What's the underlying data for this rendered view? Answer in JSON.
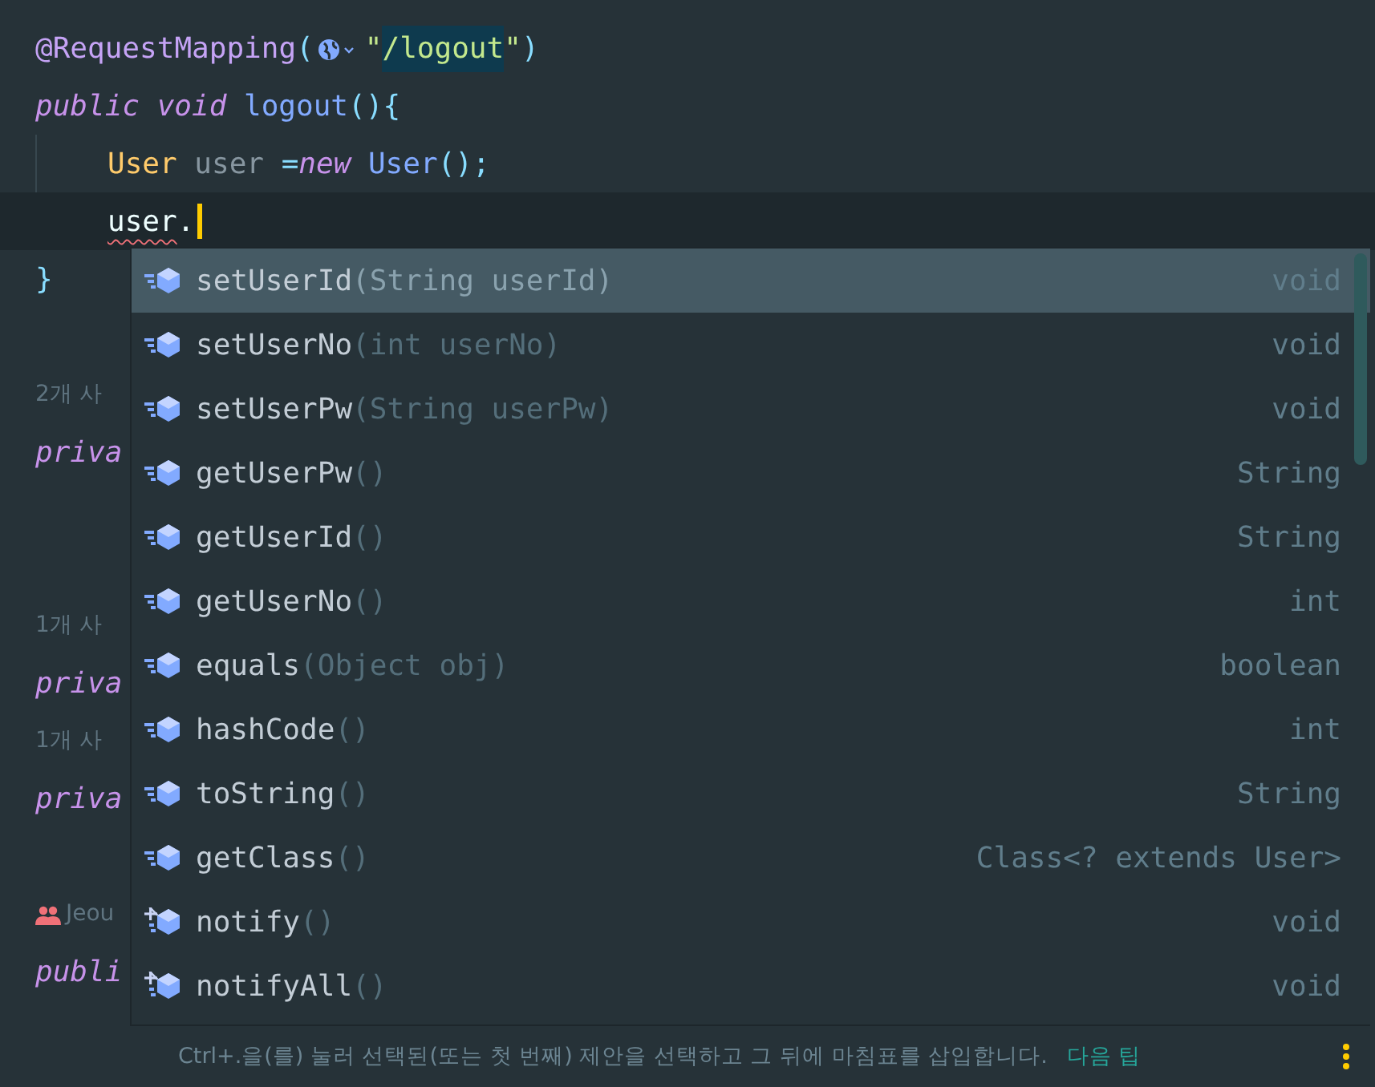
{
  "editor": {
    "lines": [
      {
        "tokens": [
          {
            "kind": "annotation",
            "text": "@RequestMapping"
          },
          {
            "kind": "punct",
            "text": "("
          },
          {
            "kind": "url-icon"
          },
          {
            "kind": "string",
            "text": "\""
          },
          {
            "kind": "string-match",
            "text": "/logout"
          },
          {
            "kind": "string",
            "text": "\""
          },
          {
            "kind": "punct",
            "text": ")"
          }
        ]
      },
      {
        "tokens": [
          {
            "kind": "keyword",
            "text": "public"
          },
          {
            "kind": "keyword",
            "text": "void"
          },
          {
            "kind": "function",
            "text": "logout"
          },
          {
            "kind": "punct",
            "text": "(){"
          }
        ],
        "children": [
          {
            "tokens": [
              {
                "kind": "type",
                "text": "User"
              },
              {
                "kind": "unused",
                "text": "user"
              },
              {
                "kind": "punct",
                "text": "="
              },
              {
                "kind": "keyword",
                "text": "new"
              },
              {
                "kind": "call",
                "text": "User"
              },
              {
                "kind": "punct",
                "text": "();"
              }
            ]
          },
          {
            "tokens": [
              {
                "kind": "error",
                "text": "user"
              },
              {
                "kind": "plain",
                "text": "."
              },
              {
                "kind": "caret"
              }
            ]
          }
        ]
      },
      {
        "tokens": [
          {
            "kind": "punct",
            "text": "}"
          }
        ]
      },
      {
        "tokens": [
          {
            "kind": "blank"
          }
        ]
      },
      {
        "tokens": [
          {
            "kind": "hint",
            "text": "2개 사"
          }
        ]
      },
      {
        "tokens": [
          {
            "kind": "keyword",
            "text": "priva"
          }
        ]
      },
      {
        "tokens": [
          {
            "kind": "blank"
          }
        ]
      },
      {
        "tokens": [
          {
            "kind": "blank"
          }
        ]
      },
      {
        "tokens": [
          {
            "kind": "hint",
            "text": "1개 사"
          }
        ]
      },
      {
        "tokens": [
          {
            "kind": "keyword",
            "text": "priva"
          }
        ]
      },
      {
        "tokens": [
          {
            "kind": "hint",
            "text": "1개 사"
          }
        ]
      },
      {
        "tokens": [
          {
            "kind": "keyword",
            "text": "priva"
          }
        ]
      },
      {
        "tokens": [
          {
            "kind": "blank"
          }
        ]
      },
      {
        "tokens": [
          {
            "kind": "author-icon"
          },
          {
            "kind": "hint",
            "text": "Jeou"
          }
        ]
      },
      {
        "tokens": [
          {
            "kind": "keyword",
            "text": "publi"
          }
        ]
      }
    ]
  },
  "completion": {
    "items": [
      {
        "kind": "method",
        "name": "setUserId",
        "params": "(String userId)",
        "return_type": "void",
        "selected": true
      },
      {
        "kind": "method",
        "name": "setUserNo",
        "params": "(int userNo)",
        "return_type": "void",
        "selected": false
      },
      {
        "kind": "method",
        "name": "setUserPw",
        "params": "(String userPw)",
        "return_type": "void",
        "selected": false
      },
      {
        "kind": "method",
        "name": "getUserPw",
        "params": "()",
        "return_type": "String",
        "selected": false
      },
      {
        "kind": "method",
        "name": "getUserId",
        "params": "()",
        "return_type": "String",
        "selected": false
      },
      {
        "kind": "method",
        "name": "getUserNo",
        "params": "()",
        "return_type": "int",
        "selected": false
      },
      {
        "kind": "method",
        "name": "equals",
        "params": "(Object obj)",
        "return_type": "boolean",
        "selected": false
      },
      {
        "kind": "method",
        "name": "hashCode",
        "params": "()",
        "return_type": "int",
        "selected": false
      },
      {
        "kind": "method",
        "name": "toString",
        "params": "()",
        "return_type": "String",
        "selected": false
      },
      {
        "kind": "method",
        "name": "getClass",
        "params": "()",
        "return_type": "Class<? extends User>",
        "selected": false
      },
      {
        "kind": "native-method",
        "name": "notify",
        "params": "()",
        "return_type": "void",
        "selected": false
      },
      {
        "kind": "native-method",
        "name": "notifyAll",
        "params": "()",
        "return_type": "void",
        "selected": false
      }
    ],
    "hint": {
      "text": "Ctrl+.을(를) 눌러 선택된(또는 첫 번째) 제안을 선택하고 그 뒤에 마침표를 삽입합니다.",
      "link": "다음 팁"
    }
  }
}
